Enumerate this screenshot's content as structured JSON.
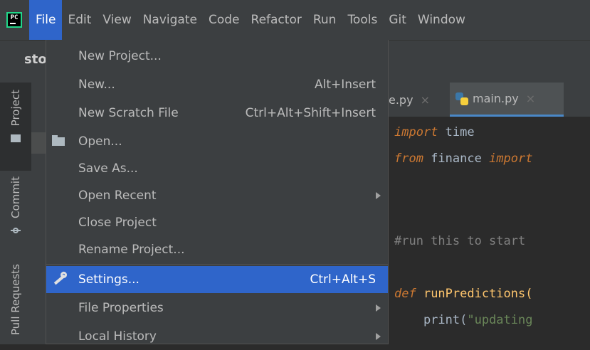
{
  "menubar": {
    "logo_text": "PC",
    "items": [
      {
        "label": "File",
        "mnemonic_first": true
      },
      {
        "label": "Edit"
      },
      {
        "label": "View"
      },
      {
        "label": "Navigate"
      },
      {
        "label": "Code"
      },
      {
        "label": "Refactor"
      },
      {
        "label": "Run"
      },
      {
        "label": "Tools"
      },
      {
        "label": "Git"
      },
      {
        "label": "Window"
      }
    ]
  },
  "project": {
    "crumb": "sto"
  },
  "left_strip": {
    "tabs": [
      {
        "label": "Project",
        "icon": "folder-icon"
      },
      {
        "label": "Commit",
        "icon": "commit-icon"
      },
      {
        "label": "Pull Requests",
        "icon": "pull-request-icon"
      }
    ]
  },
  "editor": {
    "tabs": [
      {
        "label": "e.py",
        "close": "×"
      },
      {
        "label": "main.py",
        "close": "×",
        "icon": "python-file-icon"
      }
    ]
  },
  "file_menu": {
    "items": [
      {
        "label": "New Project...",
        "shortcut": ""
      },
      {
        "label": "New...",
        "shortcut": "Alt+Insert"
      },
      {
        "label": "New Scratch File",
        "shortcut": "Ctrl+Alt+Shift+Insert"
      },
      {
        "label": "Open...",
        "shortcut": "",
        "icon": "open-folder-icon"
      },
      {
        "label": "Save As...",
        "shortcut": ""
      },
      {
        "label": "Open Recent",
        "shortcut": "",
        "submenu": true
      },
      {
        "label": "Close Project",
        "shortcut": ""
      },
      {
        "label": "Rename Project...",
        "shortcut": ""
      },
      {
        "label": "Settings...",
        "shortcut": "Ctrl+Alt+S",
        "icon": "wrench-icon",
        "highlighted": true
      },
      {
        "label": "File Properties",
        "shortcut": "",
        "submenu": true
      },
      {
        "label": "Local History",
        "shortcut": "",
        "submenu": true
      }
    ]
  },
  "code": {
    "line1_kw": "import",
    "line1_rest": " time",
    "line2_kw": "from",
    "line2_mid": " finance ",
    "line2_kw2": "import",
    "comment": "#run this to start",
    "def_kw": "def",
    "def_name": " runPredictions(",
    "print_call": "    print(",
    "print_str": "\"updating",
    "next_line": "    ...   p ..."
  },
  "colors": {
    "accent": "#2f65ca",
    "menubar_bg": "#3c3f41",
    "editor_bg": "#2b2b2b",
    "keyword": "#cc7832",
    "comment": "#808080",
    "string": "#6a8759",
    "function": "#ffc66d"
  }
}
